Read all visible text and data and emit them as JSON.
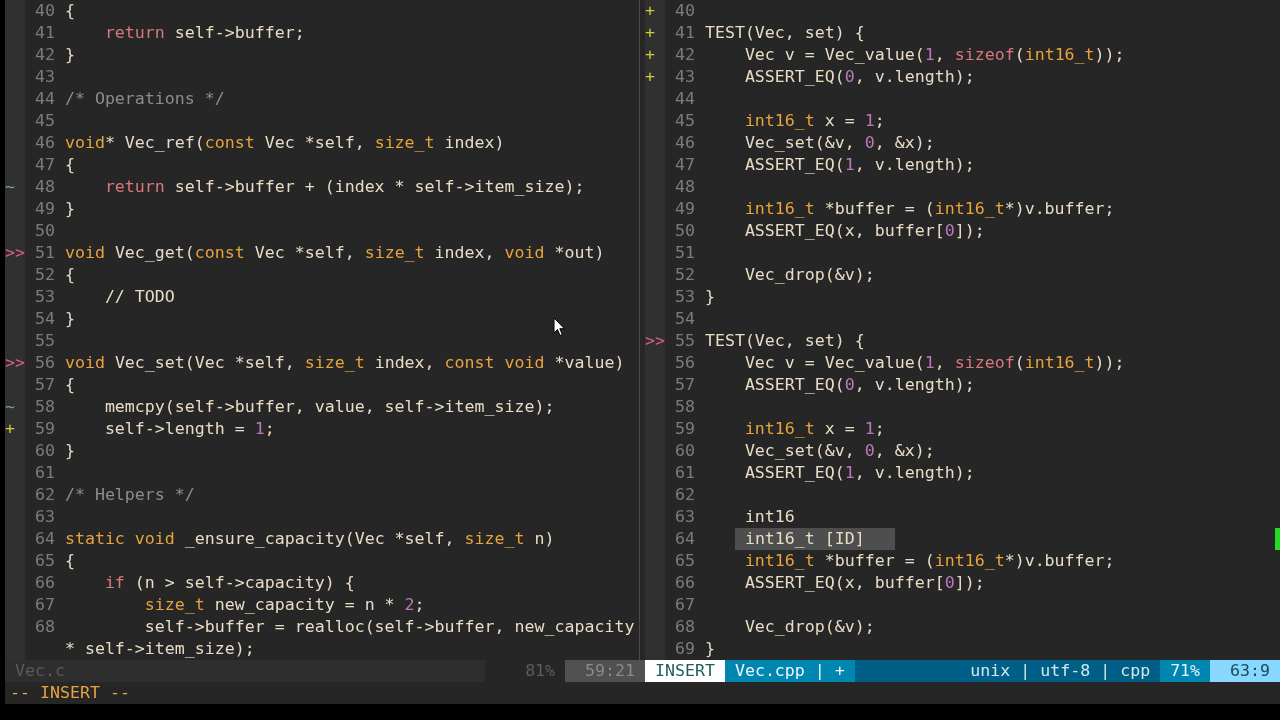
{
  "panes": [
    {
      "active": false,
      "lines": [
        {
          "number": "40",
          "code": [
            {
              "text": "{",
              "kind": "plain"
            }
          ]
        },
        {
          "number": "41",
          "code": [
            {
              "text": "    return",
              "kind": "control"
            },
            {
              "text": " self->buffer;",
              "kind": "plain"
            }
          ]
        },
        {
          "number": "42",
          "code": [
            {
              "text": "}",
              "kind": "plain"
            }
          ]
        },
        {
          "number": "43"
        },
        {
          "number": "44",
          "code": [
            {
              "text": "/* Operations */",
              "kind": "comment"
            }
          ]
        },
        {
          "number": "45"
        },
        {
          "number": "46",
          "code": [
            {
              "text": "void",
              "kind": "type"
            },
            {
              "text": "* Vec_ref(",
              "kind": "plain"
            },
            {
              "text": "const",
              "kind": "type"
            },
            {
              "text": " Vec *self, ",
              "kind": "plain"
            },
            {
              "text": "size_t",
              "kind": "type"
            },
            {
              "text": " index)",
              "kind": "plain"
            }
          ]
        },
        {
          "number": "47",
          "code": [
            {
              "text": "{",
              "kind": "plain"
            }
          ]
        },
        {
          "number": "48",
          "sign": {
            "text": "~",
            "kind": "change"
          },
          "code": [
            {
              "text": "    return",
              "kind": "control"
            },
            {
              "text": " self->buffer + (index * self->item_size);",
              "kind": "plain"
            }
          ]
        },
        {
          "number": "49",
          "code": [
            {
              "text": "}",
              "kind": "plain"
            }
          ]
        },
        {
          "number": "50"
        },
        {
          "number": "51",
          "sign": {
            "text": ">>",
            "kind": "mark"
          },
          "code": [
            {
              "text": "void",
              "kind": "type"
            },
            {
              "text": " Vec_get(",
              "kind": "plain"
            },
            {
              "text": "const",
              "kind": "type"
            },
            {
              "text": " Vec *self, ",
              "kind": "plain"
            },
            {
              "text": "size_t",
              "kind": "type"
            },
            {
              "text": " index, ",
              "kind": "plain"
            },
            {
              "text": "void",
              "kind": "type"
            },
            {
              "text": " *out)",
              "kind": "plain"
            }
          ]
        },
        {
          "number": "52",
          "code": [
            {
              "text": "{",
              "kind": "plain"
            }
          ]
        },
        {
          "number": "53",
          "code": [
            {
              "text": "    // TODO",
              "kind": "plain"
            }
          ]
        },
        {
          "number": "54",
          "code": [
            {
              "text": "}",
              "kind": "plain"
            }
          ]
        },
        {
          "number": "55"
        },
        {
          "number": "56",
          "sign": {
            "text": ">>",
            "kind": "mark"
          },
          "code": [
            {
              "text": "void",
              "kind": "type"
            },
            {
              "text": " Vec_set(Vec *self, ",
              "kind": "plain"
            },
            {
              "text": "size_t",
              "kind": "type"
            },
            {
              "text": " index, ",
              "kind": "plain"
            },
            {
              "text": "const",
              "kind": "type"
            },
            {
              "text": " void",
              "kind": "type"
            },
            {
              "text": " *value)",
              "kind": "plain"
            }
          ]
        },
        {
          "number": "57",
          "code": [
            {
              "text": "{",
              "kind": "plain"
            }
          ]
        },
        {
          "number": "58",
          "sign": {
            "text": "~",
            "kind": "change"
          },
          "code": [
            {
              "text": "    memcpy(self->buffer, value, self->item_size);",
              "kind": "plain"
            }
          ]
        },
        {
          "number": "59",
          "sign": {
            "text": "+",
            "kind": "add"
          },
          "code": [
            {
              "text": "    self->length = ",
              "kind": "plain"
            },
            {
              "text": "1",
              "kind": "number"
            },
            {
              "text": ";",
              "kind": "plain"
            }
          ]
        },
        {
          "number": "60",
          "code": [
            {
              "text": "}",
              "kind": "plain"
            }
          ]
        },
        {
          "number": "61"
        },
        {
          "number": "62",
          "code": [
            {
              "text": "/* Helpers */",
              "kind": "comment"
            }
          ]
        },
        {
          "number": "63"
        },
        {
          "number": "64",
          "code": [
            {
              "text": "static",
              "kind": "type"
            },
            {
              "text": " void",
              "kind": "type"
            },
            {
              "text": " _ensure_capacity(Vec *self, ",
              "kind": "plain"
            },
            {
              "text": "size_t",
              "kind": "type"
            },
            {
              "text": " n)",
              "kind": "plain"
            }
          ]
        },
        {
          "number": "65",
          "code": [
            {
              "text": "{",
              "kind": "plain"
            }
          ]
        },
        {
          "number": "66",
          "code": [
            {
              "text": "    if",
              "kind": "control"
            },
            {
              "text": " (n > self->capacity) {",
              "kind": "plain"
            }
          ]
        },
        {
          "number": "67",
          "code": [
            {
              "text": "        size_t",
              "kind": "type"
            },
            {
              "text": " new_capacity = n * ",
              "kind": "plain"
            },
            {
              "text": "2",
              "kind": "number"
            },
            {
              "text": ";",
              "kind": "plain"
            }
          ]
        },
        {
          "number": "68",
          "code": [
            {
              "text": "        self->buffer = realloc(self->buffer, new_capacity",
              "kind": "plain"
            }
          ],
          "wrap": [
            {
              "text": "* self->item_size);",
              "kind": "plain"
            }
          ]
        }
      ],
      "status": [
        {
          "kind": "file",
          "text": "Vec.c"
        },
        {
          "kind": "fill"
        },
        {
          "kind": "percent",
          "text": "81%"
        },
        {
          "kind": "position",
          "text": "59:21"
        }
      ]
    },
    {
      "active": true,
      "lines": [
        {
          "number": "40",
          "sign": {
            "text": "+",
            "kind": "add"
          }
        },
        {
          "number": "41",
          "sign": {
            "text": "+",
            "kind": "add"
          },
          "code": [
            {
              "text": "TEST(Vec, set) {",
              "kind": "plain"
            }
          ]
        },
        {
          "number": "42",
          "sign": {
            "text": "+",
            "kind": "add"
          },
          "code": [
            {
              "text": "    Vec v = Vec_value(",
              "kind": "plain"
            },
            {
              "text": "1",
              "kind": "number"
            },
            {
              "text": ", ",
              "kind": "plain"
            },
            {
              "text": "sizeof",
              "kind": "control"
            },
            {
              "text": "(",
              "kind": "plain"
            },
            {
              "text": "int16_t",
              "kind": "type"
            },
            {
              "text": "));",
              "kind": "plain"
            }
          ]
        },
        {
          "number": "43",
          "sign": {
            "text": "+",
            "kind": "add"
          },
          "code": [
            {
              "text": "    ASSERT_EQ(",
              "kind": "plain"
            },
            {
              "text": "0",
              "kind": "number"
            },
            {
              "text": ", v.length);",
              "kind": "plain"
            }
          ]
        },
        {
          "number": "44"
        },
        {
          "number": "45",
          "code": [
            {
              "text": "    int16_t",
              "kind": "type"
            },
            {
              "text": " x = ",
              "kind": "plain"
            },
            {
              "text": "1",
              "kind": "number"
            },
            {
              "text": ";",
              "kind": "plain"
            }
          ]
        },
        {
          "number": "46",
          "code": [
            {
              "text": "    Vec_set(&v, ",
              "kind": "plain"
            },
            {
              "text": "0",
              "kind": "number"
            },
            {
              "text": ", &x);",
              "kind": "plain"
            }
          ]
        },
        {
          "number": "47",
          "code": [
            {
              "text": "    ASSERT_EQ(",
              "kind": "plain"
            },
            {
              "text": "1",
              "kind": "number"
            },
            {
              "text": ", v.length);",
              "kind": "plain"
            }
          ]
        },
        {
          "number": "48"
        },
        {
          "number": "49",
          "code": [
            {
              "text": "    int16_t",
              "kind": "type"
            },
            {
              "text": " *buffer = (",
              "kind": "plain"
            },
            {
              "text": "int16_t",
              "kind": "type"
            },
            {
              "text": "*)v.buffer;",
              "kind": "plain"
            }
          ]
        },
        {
          "number": "50",
          "code": [
            {
              "text": "    ASSERT_EQ(x, buffer[",
              "kind": "plain"
            },
            {
              "text": "0",
              "kind": "number"
            },
            {
              "text": "]);",
              "kind": "plain"
            }
          ]
        },
        {
          "number": "51"
        },
        {
          "number": "52",
          "code": [
            {
              "text": "    Vec_drop(&v);",
              "kind": "plain"
            }
          ]
        },
        {
          "number": "53",
          "code": [
            {
              "text": "}",
              "kind": "plain"
            }
          ]
        },
        {
          "number": "54"
        },
        {
          "number": "55",
          "sign": {
            "text": ">>",
            "kind": "mark"
          },
          "code": [
            {
              "text": "TEST(Vec, set) {",
              "kind": "plain"
            }
          ]
        },
        {
          "number": "56",
          "code": [
            {
              "text": "    Vec v = Vec_value(",
              "kind": "plain"
            },
            {
              "text": "1",
              "kind": "number"
            },
            {
              "text": ", ",
              "kind": "plain"
            },
            {
              "text": "sizeof",
              "kind": "control"
            },
            {
              "text": "(",
              "kind": "plain"
            },
            {
              "text": "int16_t",
              "kind": "type"
            },
            {
              "text": "));",
              "kind": "plain"
            }
          ]
        },
        {
          "number": "57",
          "code": [
            {
              "text": "    ASSERT_EQ(",
              "kind": "plain"
            },
            {
              "text": "0",
              "kind": "number"
            },
            {
              "text": ", v.length);",
              "kind": "plain"
            }
          ]
        },
        {
          "number": "58"
        },
        {
          "number": "59",
          "code": [
            {
              "text": "    int16_t",
              "kind": "type"
            },
            {
              "text": " x = ",
              "kind": "plain"
            },
            {
              "text": "1",
              "kind": "number"
            },
            {
              "text": ";",
              "kind": "plain"
            }
          ]
        },
        {
          "number": "60",
          "code": [
            {
              "text": "    Vec_set(&v, ",
              "kind": "plain"
            },
            {
              "text": "0",
              "kind": "number"
            },
            {
              "text": ", &x);",
              "kind": "plain"
            }
          ]
        },
        {
          "number": "61",
          "code": [
            {
              "text": "    ASSERT_EQ(",
              "kind": "plain"
            },
            {
              "text": "1",
              "kind": "number"
            },
            {
              "text": ", v.length);",
              "kind": "plain"
            }
          ]
        },
        {
          "number": "62"
        },
        {
          "number": "63",
          "code": [
            {
              "text": "    int16",
              "kind": "plain"
            }
          ]
        },
        {
          "number": "64",
          "popup": [
            {
              "text": "int16_t [ID]",
              "selected": true
            }
          ]
        },
        {
          "number": "65",
          "code": [
            {
              "text": "    int16_t",
              "kind": "type"
            },
            {
              "text": " *buffer = (",
              "kind": "plain"
            },
            {
              "text": "int16_t",
              "kind": "type"
            },
            {
              "text": "*)v.buffer;",
              "kind": "plain"
            }
          ]
        },
        {
          "number": "66",
          "code": [
            {
              "text": "    ASSERT_EQ(x, buffer[",
              "kind": "plain"
            },
            {
              "text": "0",
              "kind": "number"
            },
            {
              "text": "]);",
              "kind": "plain"
            }
          ]
        },
        {
          "number": "67"
        },
        {
          "number": "68",
          "code": [
            {
              "text": "    Vec_drop(&v);",
              "kind": "plain"
            }
          ]
        },
        {
          "number": "69",
          "code": [
            {
              "text": "}",
              "kind": "plain"
            }
          ]
        }
      ],
      "status": [
        {
          "kind": "mode",
          "text": "INSERT"
        },
        {
          "kind": "file",
          "text": "Vec.cpp | +"
        },
        {
          "kind": "info",
          "text": "unix | utf-8 | cpp"
        },
        {
          "kind": "percent",
          "text": "71%"
        },
        {
          "kind": "position",
          "text": "63:9"
        }
      ]
    }
  ],
  "command_line": "-- INSERT --"
}
